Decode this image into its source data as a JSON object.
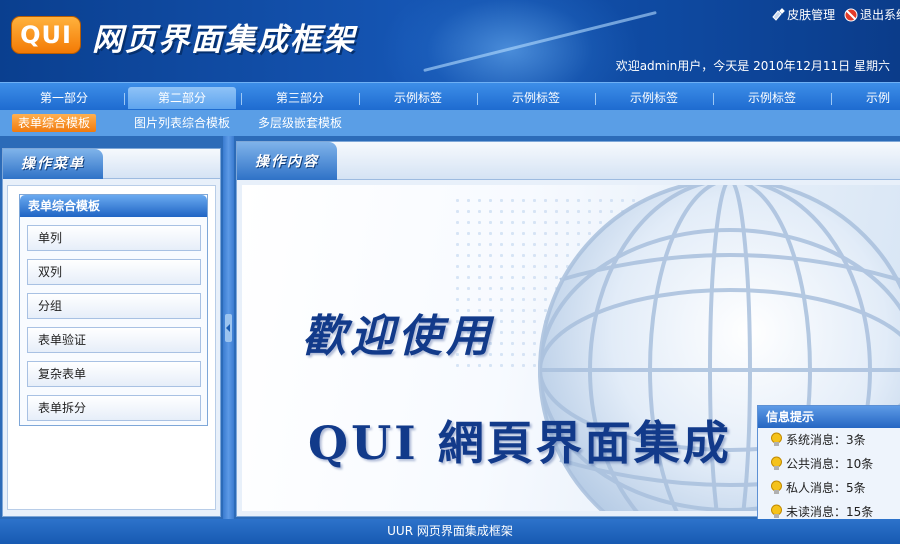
{
  "app": {
    "logo_text": "QUI",
    "title": "网页界面集成框架"
  },
  "top_links": {
    "skin": "皮肤管理",
    "logout": "退出系统"
  },
  "welcome_text": "欢迎admin用户，今天是 2010年12月11日 星期六",
  "nav": {
    "tabs": [
      "第一部分",
      "第二部分",
      "第三部分",
      "示例标签",
      "示例标签",
      "示例标签",
      "示例标签",
      "示例标"
    ],
    "active_index": 1
  },
  "subnav": {
    "items": [
      "表单综合模板",
      "图片列表综合模板",
      "多层级嵌套模板"
    ],
    "active_index": 0
  },
  "left_panel": {
    "title": "操作菜单",
    "group_title": "表单综合模板",
    "items": [
      "单列",
      "双列",
      "分组",
      "表单验证",
      "复杂表单",
      "表单拆分"
    ]
  },
  "right_panel": {
    "title": "操作内容",
    "welcome_line1": "歡迎使用",
    "welcome_line2": "QUI 網頁界面集成"
  },
  "info_popup": {
    "title": "信息提示",
    "rows": [
      "系统消息：3条",
      "公共消息：10条",
      "私人消息：5条",
      "未读消息：15条"
    ]
  },
  "footer": {
    "text": "UUR 网页界面集成框架"
  },
  "colors": {
    "header_blue": "#1555b3",
    "nav_blue": "#2e7ddc",
    "accent_orange": "#f37a05",
    "text_dark_blue": "#123a8a"
  },
  "icons": {
    "skin": "skin-icon",
    "logout": "logout-icon",
    "info": "lightbulb-icon"
  }
}
